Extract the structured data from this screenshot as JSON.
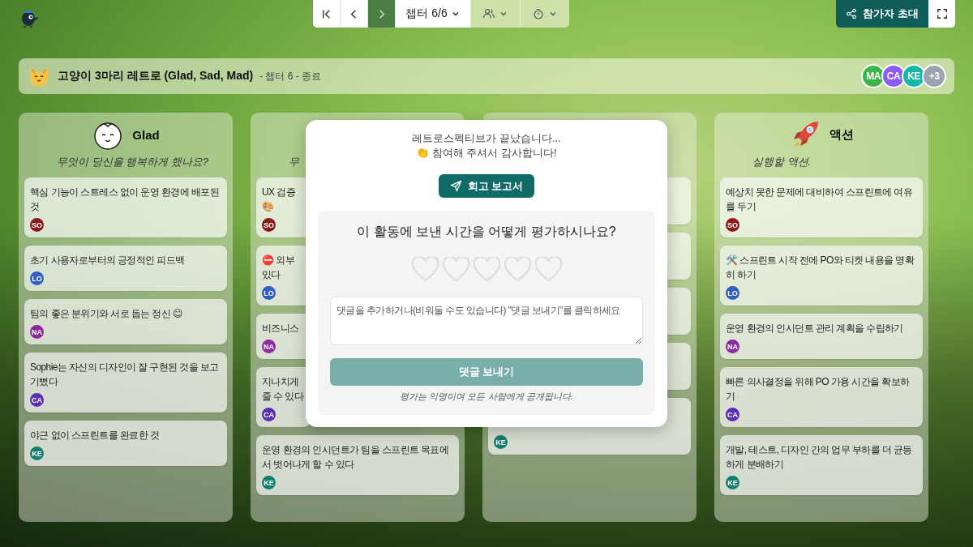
{
  "toolbar": {
    "nav": [
      {
        "kind": "first"
      },
      {
        "kind": "prev"
      },
      {
        "kind": "next"
      }
    ],
    "chapter": "챕터 6/6",
    "menus": [
      {
        "kind": "people"
      },
      {
        "kind": "timer"
      }
    ],
    "invite": "참가자 초대"
  },
  "header": {
    "title": "고양이 3마리 레트로 (Glad, Sad, Mad)",
    "subtitle": "- 챕터 6 - 종료",
    "participants": [
      {
        "initials": "MA",
        "color": "#3cb54a"
      },
      {
        "initials": "CA",
        "color": "#8b5cf6"
      },
      {
        "initials": "KE",
        "color": "#14b8a6"
      },
      {
        "initials": "+3",
        "color": "#9ca3af"
      }
    ]
  },
  "columns": [
    {
      "title": "Glad",
      "subtitle": "무엇이 당신을 행복하게 했나요?",
      "cards": [
        {
          "text": "핵심 기능이 스트레스 없이 운영 환경에 배포된 것",
          "author": "SO",
          "color": "#8b1a1a"
        },
        {
          "text": "초기 사용자로부터의 긍정적인 피드백",
          "author": "LO",
          "color": "#2f5fc4"
        },
        {
          "text": "팀의 좋은 분위기와 서로 돕는 정신 😊",
          "author": "NA",
          "color": "#8e2aa0"
        },
        {
          "text": "Sophie는 자신의 디자인이 잘 구현된 것을 보고 기뻤다",
          "author": "CA",
          "color": "#5b2fb5"
        },
        {
          "text": "야근 없이 스프린트를 완료한 것",
          "author": "KE",
          "color": "#0f7f70"
        }
      ]
    },
    {
      "subtitle": "무",
      "cards": [
        {
          "text": "UX 검증\n🎨",
          "author": "SO",
          "color": "#8b1a1a"
        },
        {
          "text": "⛔ 외부\n있다",
          "author": "LO",
          "color": "#2f5fc4"
        },
        {
          "text": "비즈니스",
          "author": "NA",
          "color": "#8e2aa0"
        },
        {
          "text": "지나치게\n줄 수 있다",
          "author": "CA",
          "color": "#5b2fb5"
        },
        {
          "text": "운영 환경의 인시던트가 팀을 스프린트 목표에서 벗어나게 할 수 있다",
          "author": "KE",
          "color": "#0f7f70"
        }
      ]
    },
    {
      "cards": [
        {
          "kind": "covered"
        },
        {
          "kind": "covered"
        },
        {
          "kind": "covered"
        },
        {
          "kind": "covered"
        },
        {
          "kind": "note",
          "author": "KE",
          "color": "#0f7f70"
        }
      ]
    },
    {
      "title": "액션",
      "subtitle": "실행할 액션.",
      "cards": [
        {
          "text": "예상치 못한 문제에 대비하여 스프린트에 여유를 두기",
          "author": "SO",
          "color": "#8b1a1a"
        },
        {
          "text": "🛠️ 스프린트 시작 전에 PO와 티켓 내용을 명확히 하기",
          "author": "LO",
          "color": "#2f5fc4"
        },
        {
          "text": "운영 환경의 인시던트 관리 계획을 수립하기",
          "author": "NA",
          "color": "#8e2aa0"
        },
        {
          "text": "빠른 의사결정을 위해 PO 가용 시간을 확보하기",
          "author": "CA",
          "color": "#5b2fb5"
        },
        {
          "text": "개발, 테스트, 디자인 간의 업무 부하를 더 균등하게 분배하기",
          "author": "KE",
          "color": "#0f7f70"
        }
      ]
    }
  ],
  "modal": {
    "message": "레트로스펙티브가 끝났습니다...",
    "thanks": "👏 참여해 주셔서 감사합니다!",
    "report_button": "회고 보고서",
    "question": "이 활동에 보낸 시간을 어떻게 평가하시나요?",
    "rating": {
      "stars": 0
    },
    "comment": {
      "placeholder": "댓글을 추가하거나(비워둘 수도 있습니다) \"댓글 보내기\"를 클릭하세요"
    },
    "send_button": {
      "label": "댓글 보내기",
      "disabled": true
    },
    "note": "평가는 익명이며 모든 사람에게 공개됩니다."
  }
}
